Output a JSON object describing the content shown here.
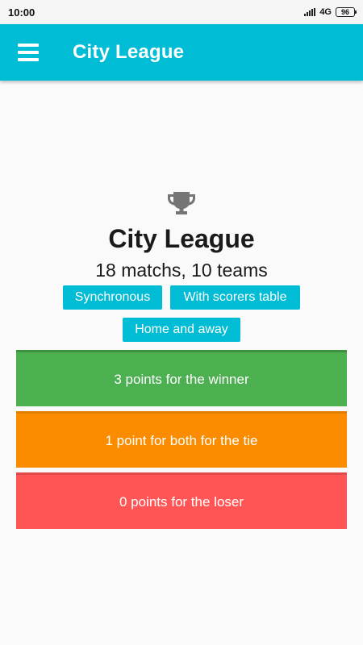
{
  "status_bar": {
    "time": "10:00",
    "network": "4G",
    "battery": "96"
  },
  "app_bar": {
    "title": "City League",
    "menu_icon": "hamburger-menu-icon"
  },
  "league": {
    "icon": "trophy-icon",
    "name": "City League",
    "summary": "18 matchs, 10 teams",
    "tags": [
      "Synchronous",
      "With scorers table",
      "Home and away"
    ]
  },
  "points_rules": [
    {
      "label": "3 points for the winner",
      "color": "#4caf50"
    },
    {
      "label": "1 point for both for the tie",
      "color": "#fb8c00"
    },
    {
      "label": "0 points for the loser",
      "color": "#ff5555"
    }
  ],
  "colors": {
    "accent": "#00bcd4",
    "background": "#fafafa"
  }
}
